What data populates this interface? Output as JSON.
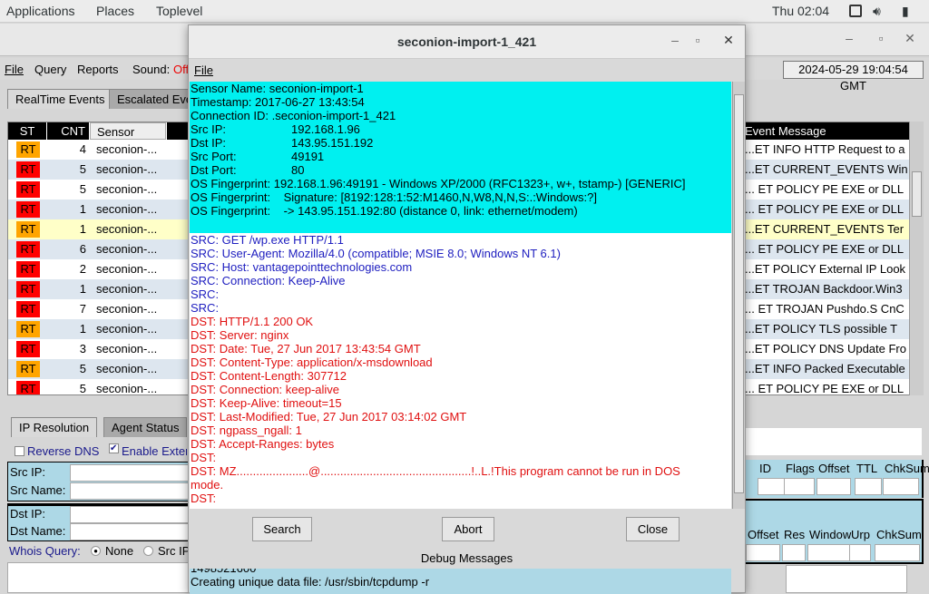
{
  "topbar": {
    "applications": "Applications",
    "places": "Places",
    "toplevel": "Toplevel",
    "clock": "Thu 02:04"
  },
  "main": {
    "menu": {
      "file": "File",
      "query": "Query",
      "reports": "Reports",
      "sound_label": "Sound:",
      "sound_value": "Off"
    },
    "datetime": "2024-05-29 19:04:54 GMT",
    "tabs": [
      "RealTime Events",
      "Escalated Events"
    ],
    "columns": {
      "st": "ST",
      "cnt": "CNT",
      "sensor": "Sensor",
      "event_message": "Event Message"
    },
    "rows": [
      {
        "st": "RT",
        "color": "#ffa500",
        "cnt": "4",
        "sensor": "seconion-...",
        "msg": "ET INFO HTTP Request to a..."
      },
      {
        "st": "RT",
        "color": "#ff0000",
        "cnt": "5",
        "sensor": "seconion-...",
        "msg": "ET CURRENT_EVENTS Win..."
      },
      {
        "st": "RT",
        "color": "#ff0000",
        "cnt": "5",
        "sensor": "seconion-...",
        "msg": "ET POLICY PE EXE or DLL ..."
      },
      {
        "st": "RT",
        "color": "#ff0000",
        "cnt": "1",
        "sensor": "seconion-...",
        "msg": "ET POLICY PE EXE or DLL ..."
      },
      {
        "st": "RT",
        "color": "#ffa500",
        "cnt": "1",
        "sensor": "seconion-...",
        "msg": "ET CURRENT_EVENTS Ter...",
        "selected": true
      },
      {
        "st": "RT",
        "color": "#ff0000",
        "cnt": "6",
        "sensor": "seconion-...",
        "msg": "ET POLICY PE EXE or DLL ..."
      },
      {
        "st": "RT",
        "color": "#ff0000",
        "cnt": "2",
        "sensor": "seconion-...",
        "msg": "ET POLICY External IP Look..."
      },
      {
        "st": "RT",
        "color": "#ff0000",
        "cnt": "1",
        "sensor": "seconion-...",
        "msg": "ET TROJAN Backdoor.Win3..."
      },
      {
        "st": "RT",
        "color": "#ff0000",
        "cnt": "7",
        "sensor": "seconion-...",
        "msg": "ET TROJAN Pushdo.S CnC ..."
      },
      {
        "st": "RT",
        "color": "#ffa500",
        "cnt": "1",
        "sensor": "seconion-...",
        "msg": "ET POLICY TLS possible T..."
      },
      {
        "st": "RT",
        "color": "#ff0000",
        "cnt": "3",
        "sensor": "seconion-...",
        "msg": "ET POLICY DNS Update Fro..."
      },
      {
        "st": "RT",
        "color": "#ffa500",
        "cnt": "5",
        "sensor": "seconion-...",
        "msg": "ET INFO Packed Executable..."
      },
      {
        "st": "RT",
        "color": "#ff0000",
        "cnt": "5",
        "sensor": "seconion-...",
        "msg": "ET POLICY PE EXE or DLL ..."
      }
    ],
    "bottom_tabs": [
      "IP Resolution",
      "Agent Status"
    ],
    "reverse_dns": "Reverse DNS",
    "enable_external": "Enable External DNS",
    "src_ip": "Src IP:",
    "src_name": "Src Name:",
    "dst_ip": "Dst IP:",
    "dst_name": "Dst Name:",
    "whois_label": "Whois Query:",
    "whois_none": "None",
    "whois_src": "Src IP",
    "ip_hdr": [
      "ID",
      "Flags",
      "Offset",
      "TTL",
      "ChkSum"
    ],
    "tcp_hdr": [
      "Offset",
      "Res",
      "Window",
      "Urp",
      "ChkSum"
    ]
  },
  "dialog": {
    "title": "seconion-import-1_421",
    "menu_file": "File",
    "header_lines": [
      "Sensor Name: seconion-import-1",
      "Timestamp: 2017-06-27 13:43:54",
      "Connection ID: .seconion-import-1_421"
    ],
    "kv": [
      [
        "Src IP:",
        "192.168.1.96"
      ],
      [
        "Dst IP:",
        "143.95.151.192"
      ],
      [
        "Src Port:",
        "49191"
      ],
      [
        "Dst Port:",
        "80"
      ]
    ],
    "os_lines": [
      "OS Fingerprint: 192.168.1.96:49191 - Windows XP/2000 (RFC1323+, w+, tstamp-) [GENERIC]",
      "OS Fingerprint:    Signature: [8192:128:1:52:M1460,N,W8,N,N,S:.:Windows:?]",
      "OS Fingerprint:    -> 143.95.151.192:80 (distance 0, link: ethernet/modem)"
    ],
    "src_lines": [
      "SRC: GET /wp.exe HTTP/1.1",
      "SRC: User-Agent: Mozilla/4.0 (compatible; MSIE 8.0; Windows NT 6.1)",
      "SRC: Host: vantagepointtechnologies.com",
      "SRC: Connection: Keep-Alive",
      "SRC:",
      "SRC:"
    ],
    "dst_lines": [
      "DST: HTTP/1.1 200 OK",
      "DST: Server: nginx",
      "DST: Date: Tue, 27 Jun 2017 13:43:54 GMT",
      "DST: Content-Type: application/x-msdownload",
      "DST: Content-Length: 307712",
      "DST: Connection: keep-alive",
      "DST: Keep-Alive: timeout=15",
      "DST: Last-Modified: Tue, 27 Jun 2017 03:14:02 GMT",
      "DST: ngpass_ngall: 1",
      "DST: Accept-Ranges: bytes",
      "DST:",
      "DST: MZ......................@..............................................!..L.!This program cannot be run in DOS",
      "mode.",
      "DST:"
    ],
    "search": "Search",
    "abort": "Abort",
    "close": "Close",
    "debug_title": "Debug Messages",
    "debug_lines": [
      "1498521600",
      "Creating unique data file: /usr/sbin/tcpdump -r"
    ]
  }
}
